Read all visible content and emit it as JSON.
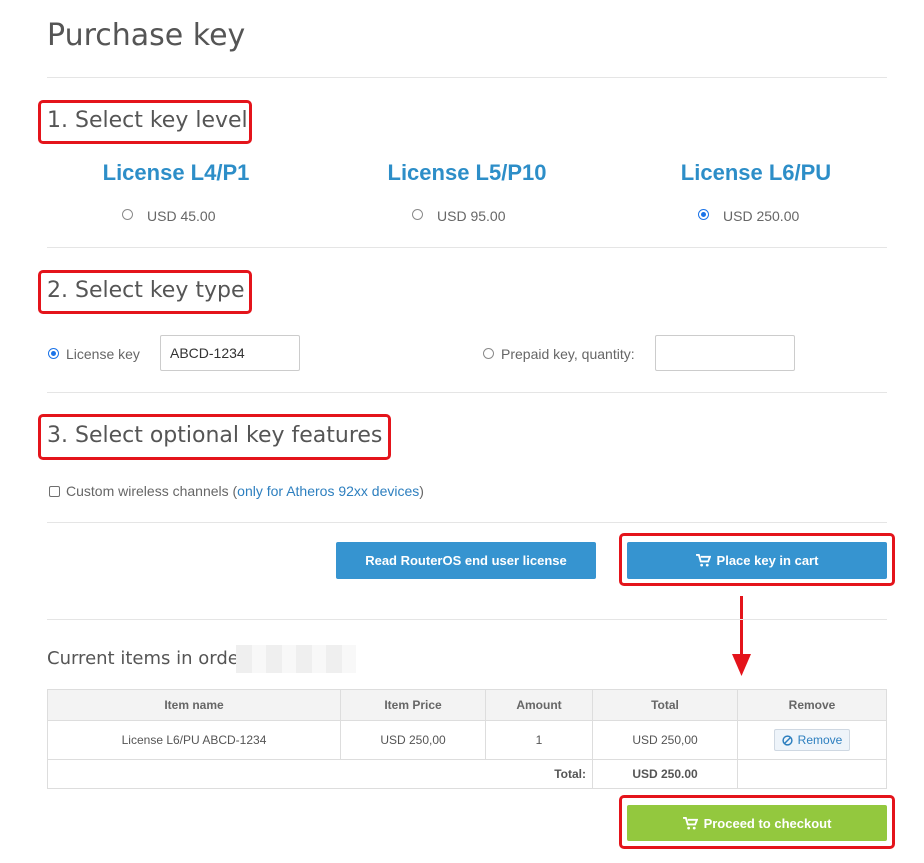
{
  "page": {
    "title": "Purchase key"
  },
  "steps": {
    "step1": "1. Select key level",
    "step2": "2. Select key type",
    "step3": "3. Select optional key features"
  },
  "licenses": [
    {
      "title": "License L4/P1",
      "price": "USD 45.00",
      "selected": false
    },
    {
      "title": "License L5/P10",
      "price": "USD 95.00",
      "selected": false
    },
    {
      "title": "License L6/PU",
      "price": "USD 250.00",
      "selected": true
    }
  ],
  "key_type": {
    "license_key_label": "License key",
    "license_key_value": "ABCD-1234",
    "license_key_selected": true,
    "prepaid_label": "Prepaid key, quantity:",
    "prepaid_value": "",
    "prepaid_selected": false
  },
  "features": {
    "wireless_label": "Custom wireless channels (",
    "wireless_link": "only for Atheros 92xx devices",
    "wireless_close": ")",
    "wireless_checked": false
  },
  "buttons": {
    "read_license": "Read RouterOS end user license",
    "place_in_cart": "Place key in cart",
    "checkout": "Proceed to checkout"
  },
  "order": {
    "title": "Current items in order",
    "columns": [
      "Item name",
      "Item Price",
      "Amount",
      "Total",
      "Remove"
    ],
    "rows": [
      {
        "name": "License L6/PU ABCD-1234",
        "price": "USD 250,00",
        "amount": "1",
        "total": "USD 250,00",
        "remove": "Remove"
      }
    ],
    "total_label": "Total:",
    "total_value": "USD 250.00"
  },
  "colors": {
    "accent_blue": "#3694d0",
    "title_blue": "#2d8ec8",
    "accent_green": "#93c83e",
    "highlight_red": "#e4141b"
  },
  "icons": [
    "cart-icon",
    "ban-icon",
    "arrow-down-icon"
  ]
}
